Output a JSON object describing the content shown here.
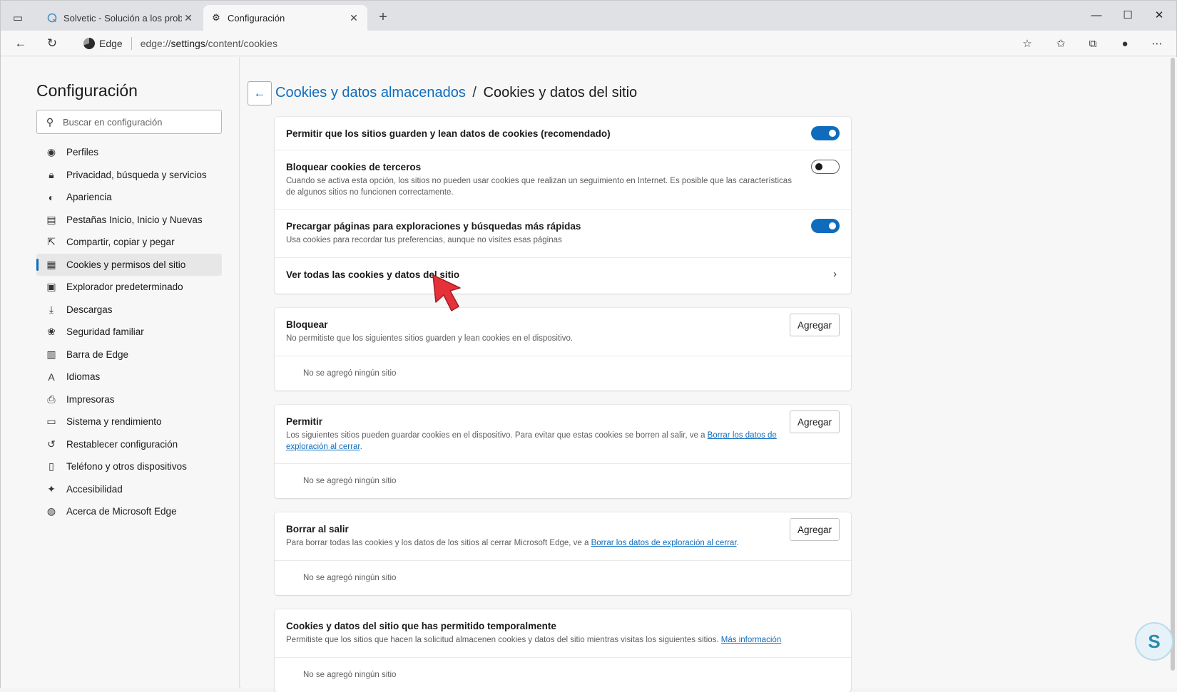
{
  "browser": {
    "tabs": [
      {
        "title": "Solvetic - Solución a los problem",
        "icon": "solvetic-favicon-icon"
      },
      {
        "title": "Configuración",
        "icon": "gear-icon"
      }
    ],
    "address": {
      "brand": "Edge",
      "url_prefix": "edge://",
      "url_host": "settings",
      "url_path": "/content/cookies"
    }
  },
  "sidebar": {
    "title": "Configuración",
    "search_placeholder": "Buscar en configuración",
    "items": [
      {
        "label": "Perfiles",
        "icon": "profile-icon"
      },
      {
        "label": "Privacidad, búsqueda y servicios",
        "icon": "lock-icon"
      },
      {
        "label": "Apariencia",
        "icon": "appearance-icon"
      },
      {
        "label": "Pestañas Inicio, Inicio y Nuevas",
        "icon": "tabs-icon"
      },
      {
        "label": "Compartir, copiar y pegar",
        "icon": "share-icon"
      },
      {
        "label": "Cookies y permisos del sitio",
        "icon": "cookies-icon",
        "active": true
      },
      {
        "label": "Explorador predeterminado",
        "icon": "default-browser-icon"
      },
      {
        "label": "Descargas",
        "icon": "download-icon"
      },
      {
        "label": "Seguridad familiar",
        "icon": "family-icon"
      },
      {
        "label": "Barra de Edge",
        "icon": "edge-bar-icon"
      },
      {
        "label": "Idiomas",
        "icon": "language-icon"
      },
      {
        "label": "Impresoras",
        "icon": "printer-icon"
      },
      {
        "label": "Sistema y rendimiento",
        "icon": "system-icon"
      },
      {
        "label": "Restablecer configuración",
        "icon": "reset-icon"
      },
      {
        "label": "Teléfono y otros dispositivos",
        "icon": "phone-icon"
      },
      {
        "label": "Accesibilidad",
        "icon": "accessibility-icon"
      },
      {
        "label": "Acerca de Microsoft Edge",
        "icon": "edge-logo-icon"
      }
    ]
  },
  "main": {
    "breadcrumb_link": "Cookies y datos almacenados",
    "breadcrumb_sep": "/",
    "breadcrumb_current": "Cookies y datos del sitio",
    "settings": {
      "allow_title": "Permitir que los sitios guarden y lean datos de cookies (recomendado)",
      "allow_on": true,
      "block_third_title": "Bloquear cookies de terceros",
      "block_third_desc": "Cuando se activa esta opción, los sitios no pueden usar cookies que realizan un seguimiento en Internet. Es posible que las características de algunos sitios no funcionen correctamente.",
      "block_third_on": false,
      "preload_title": "Precargar páginas para exploraciones y búsquedas más rápidas",
      "preload_desc": "Usa cookies para recordar tus preferencias, aunque no visites esas páginas",
      "preload_on": true,
      "see_all_title": "Ver todas las cookies y datos del sitio"
    },
    "block": {
      "title": "Bloquear",
      "desc": "No permitiste que los siguientes sitios guarden y lean cookies en el dispositivo.",
      "add_label": "Agregar",
      "empty": "No se agregó ningún sitio"
    },
    "allow": {
      "title": "Permitir",
      "desc_before": "Los siguientes sitios pueden guardar cookies en el dispositivo. Para evitar que estas cookies se borren al salir, ve a ",
      "desc_link": "Borrar los datos de exploración al cerrar",
      "desc_after": ".",
      "add_label": "Agregar",
      "empty": "No se agregó ningún sitio"
    },
    "clear_on_exit": {
      "title": "Borrar al salir",
      "desc_before": "Para borrar todas las cookies y los datos de los sitios al cerrar Microsoft Edge, ve a ",
      "desc_link": "Borrar los datos de exploración al cerrar",
      "desc_after": ".",
      "add_label": "Agregar",
      "empty": "No se agregó ningún sitio"
    },
    "temporary": {
      "title": "Cookies y datos del sitio que has permitido temporalmente",
      "desc_before": "Permitiste que los sitios que hacen la solicitud almacenen cookies y datos del sitio mientras visitas los siguientes sitios. ",
      "desc_link": "Más información",
      "empty": "No se agregó ningún sitio"
    }
  },
  "colors": {
    "accent": "#0f6cbd",
    "arrow": "#e5323a"
  }
}
